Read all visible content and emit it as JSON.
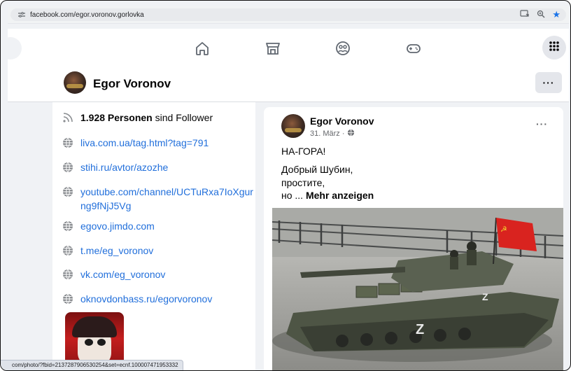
{
  "browser": {
    "url": "facebook.com/egor.voronov.gorlovka",
    "status_url": "com/photo/?fbid=2137287906530254&set=ecnf.100007471953332"
  },
  "nav": {
    "icons": [
      "home-icon",
      "marketplace-icon",
      "groups-icon",
      "gaming-icon"
    ],
    "menu_icon": "grid-menu-icon"
  },
  "profile": {
    "name": "Egor Voronov",
    "more_label": "···"
  },
  "intro": {
    "followers_count": "1.928 Personen",
    "followers_suffix": " sind Follower",
    "links": [
      "liva.com.ua/tag.html?tag=791",
      "stihi.ru/avtor/azozhe",
      "youtube.com/channel/UCTuRxa7IoXgurng9fNjJ5Vg",
      "egovo.jimdo.com",
      "t.me/eg_voronov",
      "vk.com/eg_voronov",
      "oknovdonbass.ru/egorvoronov"
    ]
  },
  "post": {
    "author": "Egor Voronov",
    "date": "31. März ·",
    "more_label": "···",
    "line1": "НА-ГОРА!",
    "line2": "Добрый Шубин,",
    "line3": "простите,",
    "line4_prefix": "но ... ",
    "see_more": "Mehr anzeigen",
    "image_marking": "Z"
  },
  "colors": {
    "link": "#216fdb",
    "background": "#f0f2f5",
    "flag": "#d9231f"
  }
}
